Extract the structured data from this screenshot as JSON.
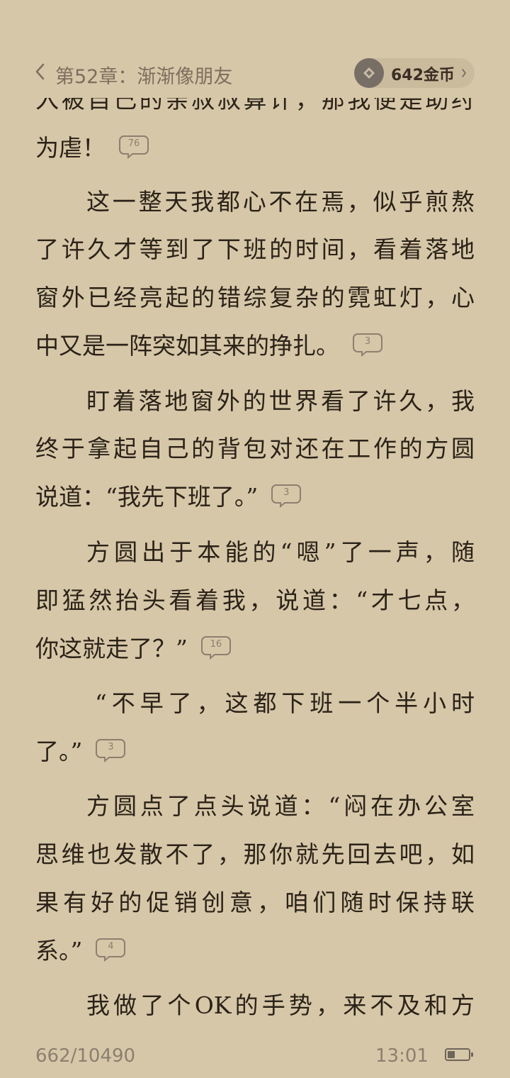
{
  "header": {
    "chapter_title": "第52章：渐渐像朋友",
    "coins": "642金币"
  },
  "paragraphs_text": [
    {
      "lines": [
        "入被自己的亲叔叔算计，那我便是助纣",
        "为虐！"
      ],
      "comment_count": "76"
    },
    {
      "lines": [
        "这一整天我都心不在焉，似乎煎熬",
        "了许久才等到了下班的时间，看着落地",
        "窗外已经亮起的错综复杂的霓虹灯，心",
        "中又是一阵突如其来的挣扎。"
      ],
      "comment_count": "3"
    },
    {
      "lines": [
        "盯着落地窗外的世界看了许久，我",
        "终于拿起自己的背包对还在工作的方圆",
        "说道：“我先下班了。”"
      ],
      "comment_count": "3"
    },
    {
      "lines": [
        "方圆出于本能的“嗯”了一声，随",
        "即猛然抬头看着我，说道：“才七点，",
        "你这就走了？”"
      ],
      "comment_count": "16"
    },
    {
      "lines": [
        "“不早了，这都下班一个半小时",
        "了。”"
      ],
      "comment_count": "3"
    },
    {
      "lines": [
        "方圆点了点头说道：“闷在办公室",
        "思维也发散不了，那你就先回去吧，如",
        "果有好的促销创意，咱们随时保持联",
        "系。”"
      ],
      "comment_count": "4"
    },
    {
      "lines": [
        "我做了个OK的手势，来不及和方"
      ],
      "comment_count": null
    }
  ],
  "footer": {
    "progress": "662/10490",
    "time": "13:01",
    "battery_level": 0.35
  },
  "colors": {
    "background": "#d6c7a8",
    "text": "#2b2218",
    "muted": "#8b7f70"
  }
}
